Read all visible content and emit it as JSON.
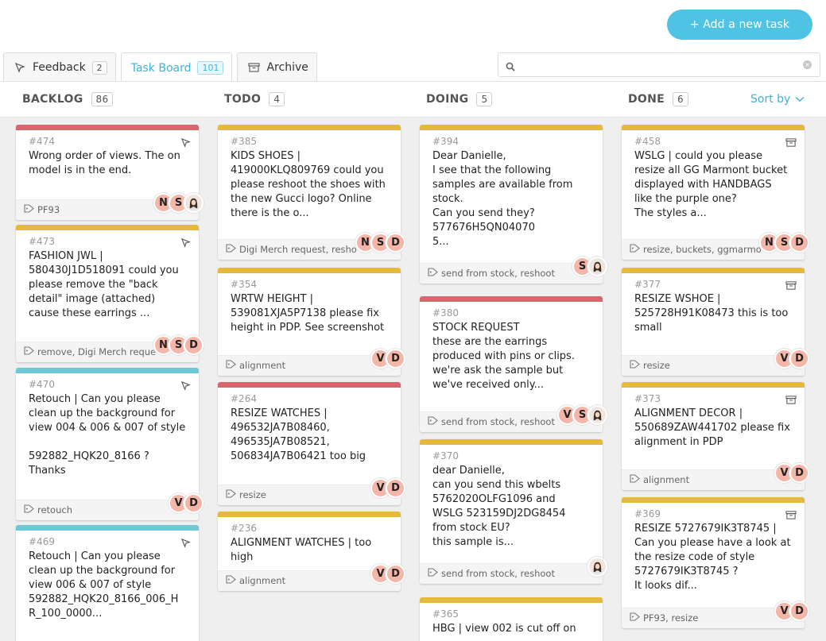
{
  "header": {
    "add_task_label": "+ Add a new task"
  },
  "tabs": [
    {
      "label": "Feedback",
      "count": "2",
      "icon": "cursor-icon"
    },
    {
      "label": "Task Board",
      "count": "101",
      "icon": ""
    },
    {
      "label": "Archive",
      "icon": "archive-icon"
    }
  ],
  "search": {
    "placeholder": "",
    "value": ""
  },
  "columns": [
    {
      "title": "BACKLOG",
      "count": "86"
    },
    {
      "title": "TODO",
      "count": "4"
    },
    {
      "title": "DOING",
      "count": "5"
    },
    {
      "title": "DONE",
      "count": "6"
    }
  ],
  "sort_label": "Sort by",
  "colors": {
    "red": "#d9666c",
    "yellow": "#e5b93c",
    "teal": "#6cc8d3",
    "accent": "#4fc3e4",
    "avatar": "#f4b6a8"
  },
  "cards": {
    "backlog": [
      {
        "id": "#474",
        "bar": "red",
        "icon": "cursor-icon",
        "text": "Wrong order of views. The on\nmodel is in the end.",
        "tags": "PF93",
        "avatars": [
          "N",
          "S",
          "photo"
        ]
      },
      {
        "id": "#473",
        "bar": "yellow",
        "icon": "cursor-icon",
        "text": "FASHION JWL |\n580430J1D518091 could you\nplease remove the \"back\ndetail\" image (attached)\ncause these earrings ...",
        "tags": "remove, Digi Merch reque",
        "avatars": [
          "N",
          "S",
          "D"
        ]
      },
      {
        "id": "#470",
        "bar": "teal",
        "icon": "cursor-icon",
        "text": "Retouch | Can you please\nclean up the background for\nview 004 & 006 & 007 of style\n\n592882_HQK20_8166 ?\nThanks",
        "tags": "retouch",
        "avatars": [
          "V",
          "D"
        ]
      },
      {
        "id": "#469",
        "bar": "teal",
        "icon": "cursor-icon",
        "text": "Retouch | Can you please\nclean up the background for\nview 006 & 007 of style\n592882_HQK20_8166_006_H\nR_100_0000...",
        "tags": "",
        "avatars": []
      }
    ],
    "todo": [
      {
        "id": "#385",
        "bar": "yellow",
        "icon": "",
        "text": "KIDS SHOES |\n419000KLQ809769 could you\nplease reshoot the shoes with\nthe new Gucci logo? Online\nthere is the o...",
        "tags": "Digi Merch request, resho",
        "avatars": [
          "N",
          "S",
          "D"
        ]
      },
      {
        "id": "#354",
        "bar": "yellow",
        "icon": "",
        "text": "WRTW HEIGHT |\n539081XJA5P7138 please fix\nheight in PDP. See screenshot",
        "tags": "alignment",
        "avatars": [
          "V",
          "D"
        ]
      },
      {
        "id": "#264",
        "bar": "red",
        "icon": "",
        "text": "RESIZE WATCHES |\n496532JA7B08460,\n496535JA7B08521,\n506834JA7B06421 too big",
        "tags": "resize",
        "avatars": [
          "V",
          "D"
        ]
      },
      {
        "id": "#236",
        "bar": "yellow",
        "icon": "",
        "text": "ALIGNMENT WATCHES | too\nhigh",
        "tags": "alignment",
        "avatars": [
          "V",
          "D"
        ]
      }
    ],
    "doing": [
      {
        "id": "#394",
        "bar": "yellow",
        "icon": "",
        "text": "Dear Danielle,\nI see that the following\nsamples are available from\nstock.\nCan you send they?\n577676H5QN04070\n5...",
        "tags": "send from stock, reshoot",
        "avatars": [
          "S",
          "photo"
        ]
      },
      {
        "id": "#380",
        "bar": "red",
        "icon": "",
        "text": "STOCK REQUEST\nthese are the earrings\nproduced with pins or clips.\nwe're ask the sample but\nwe've received only...",
        "tags": "send from stock, reshoot",
        "avatars": [
          "V",
          "S",
          "photo"
        ]
      },
      {
        "id": "#370",
        "bar": "yellow",
        "icon": "",
        "text": "dear Danielle,\ncan you send this wbelts\n5762020OLFG1096 and\nWSLG 523159DJ2DG8454\nfrom stock EU?\nthis sample is...",
        "tags": "send from stock, reshoot",
        "avatars": [
          "photo"
        ]
      },
      {
        "id": "#365",
        "bar": "yellow",
        "icon": "",
        "text": "HBG | view 002 is cut off on",
        "tags": "",
        "avatars": []
      }
    ],
    "done": [
      {
        "id": "#458",
        "bar": "yellow",
        "icon": "archive-icon",
        "text": "WSLG | could you please\nresize all GG Marmont bucket\ndisplayed with HANDBAGS\nlike the purple one?\nThe styles a...",
        "tags": "resize, buckets, ggmarmo",
        "avatars": [
          "N",
          "S",
          "D"
        ]
      },
      {
        "id": "#377",
        "bar": "yellow",
        "icon": "archive-icon",
        "text": "RESIZE WSHOE |\n525728H91K08473 this is too\nsmall",
        "tags": "resize",
        "avatars": [
          "V",
          "D"
        ]
      },
      {
        "id": "#373",
        "bar": "yellow",
        "icon": "archive-icon",
        "text": "ALIGNMENT DECOR |\n550689ZAW441702 please fix\nalignment in PDP",
        "tags": "alignment",
        "avatars": [
          "V",
          "D"
        ]
      },
      {
        "id": "#369",
        "bar": "yellow",
        "icon": "archive-icon",
        "text": "RESIZE 5727679IK3T8745 |\nCan you please have a look at\nthe resize code of style\n5727679IK3T8745 ?\nIt looks dif...",
        "tags": "PF93, resize",
        "avatars": [
          "V",
          "D"
        ]
      }
    ]
  }
}
